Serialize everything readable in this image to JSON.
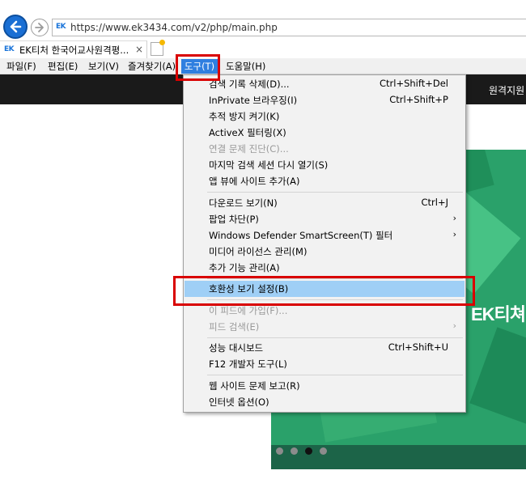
{
  "address_bar": {
    "url": "https://www.ek3434.com/v2/php/main.php",
    "favicon_text": "EK"
  },
  "tab": {
    "favicon_text": "EK",
    "title": "EK티처 한국어교사원격평...",
    "close_glyph": "×"
  },
  "menu_bar": {
    "file": "파일(F)",
    "edit": "편집(E)",
    "view": "보기(V)",
    "favorites": "즐겨찾기(A)",
    "tools": "도구(T)",
    "help": "도움말(H)"
  },
  "page": {
    "header_link": "원격지원",
    "banner_text": "EK티쳐!",
    "slider_dots": 4,
    "active_dot": 3
  },
  "tools_menu": {
    "items": [
      {
        "label": "검색 기록 삭제(D)...",
        "shortcut": "Ctrl+Shift+Del",
        "enabled": true
      },
      {
        "label": "InPrivate 브라우징(I)",
        "shortcut": "Ctrl+Shift+P",
        "enabled": true
      },
      {
        "label": "추적 방지 켜기(K)",
        "shortcut": "",
        "enabled": true
      },
      {
        "label": "ActiveX 필터링(X)",
        "shortcut": "",
        "enabled": true
      },
      {
        "label": "연결 문제 진단(C)...",
        "shortcut": "",
        "enabled": false
      },
      {
        "label": "마지막 검색 세션 다시 열기(S)",
        "shortcut": "",
        "enabled": true
      },
      {
        "label": "앱 뷰에 사이트 추가(A)",
        "shortcut": "",
        "enabled": true
      },
      {
        "label": "다운로드 보기(N)",
        "shortcut": "Ctrl+J",
        "enabled": true
      },
      {
        "label": "팝업 차단(P)",
        "shortcut": "",
        "submenu": true,
        "enabled": true
      },
      {
        "label": "Windows Defender SmartScreen(T) 필터",
        "shortcut": "",
        "submenu": true,
        "enabled": true
      },
      {
        "label": "미디어 라이선스 관리(M)",
        "shortcut": "",
        "enabled": true
      },
      {
        "label": "추가 기능 관리(A)",
        "shortcut": "",
        "enabled": true
      },
      {
        "label": "호환성 보기 설정(B)",
        "shortcut": "",
        "enabled": true,
        "highlighted": true
      },
      {
        "label": "이 피드에 가입(F)...",
        "shortcut": "",
        "enabled": false
      },
      {
        "label": "피드 검색(E)",
        "shortcut": "",
        "submenu": true,
        "enabled": false
      },
      {
        "label": "성능 대시보드",
        "shortcut": "Ctrl+Shift+U",
        "enabled": true
      },
      {
        "label": "F12 개발자 도구(L)",
        "shortcut": "",
        "enabled": true
      },
      {
        "label": "웹 사이트 문제 보고(R)",
        "shortcut": "",
        "enabled": true
      },
      {
        "label": "인터넷 옵션(O)",
        "shortcut": "",
        "enabled": true
      }
    ],
    "submenu_glyph": "›"
  },
  "colors": {
    "menu_highlight": "#2f7fe0",
    "item_highlight": "#9fcff6",
    "annotation_red": "#d90000",
    "banner_green": "#2aa16a",
    "header_dark": "#1a1a1a"
  }
}
